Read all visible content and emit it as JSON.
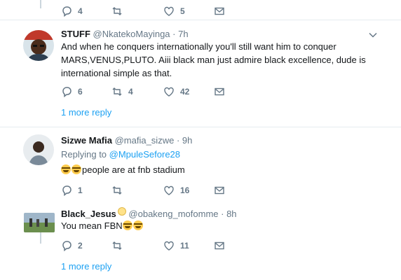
{
  "top_actions": {
    "reply_count": "4",
    "retweet_count": "",
    "like_count": "5"
  },
  "tweets": [
    {
      "name": "STUFF",
      "handle": "@NkatekoMayinga",
      "time": "· 7h",
      "text_line1": "And when he conquers internationally you'll still want him to conquer",
      "text_line2": "MARS,VENUS,PLUTO. Aiii black man just admire black excellence, dude is",
      "text_line3": "international simple as that.",
      "reply_count": "6",
      "retweet_count": "4",
      "like_count": "42",
      "more_replies": "1 more reply"
    },
    {
      "name": "Sizwe Mafia",
      "handle": "@mafia_sizwe",
      "time": "· 9h",
      "replying_prefix": "Replying to ",
      "replying_handle": "@MpuleSefore28",
      "text": "people are at fnb stadium",
      "reply_count": "1",
      "retweet_count": "",
      "like_count": "16"
    },
    {
      "name": "Black_Jesus",
      "handle": "@obakeng_mofomme",
      "time": "· 8h",
      "text": "You mean FBN",
      "reply_count": "2",
      "retweet_count": "",
      "like_count": "11",
      "more_replies": "1 more reply"
    }
  ],
  "colors": {
    "accent": "#1da1f2",
    "muted": "#657786",
    "line": "#ccd6dd",
    "divider": "#e6ecf0"
  }
}
